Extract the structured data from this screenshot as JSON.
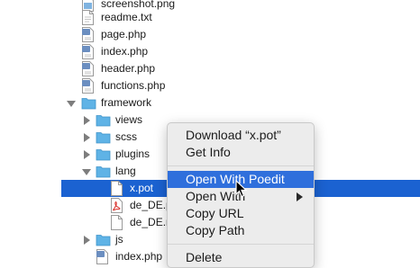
{
  "tree": {
    "items": [
      {
        "label": "screenshot.png",
        "type": "image"
      },
      {
        "label": "readme.txt",
        "type": "text"
      },
      {
        "label": "page.php",
        "type": "php"
      },
      {
        "label": "index.php",
        "type": "php"
      },
      {
        "label": "header.php",
        "type": "php"
      },
      {
        "label": "functions.php",
        "type": "php"
      },
      {
        "label": "framework",
        "type": "folder",
        "expanded": true
      },
      {
        "label": "views",
        "type": "folder",
        "expanded": false
      },
      {
        "label": "scss",
        "type": "folder",
        "expanded": false
      },
      {
        "label": "plugins",
        "type": "folder",
        "expanded": false
      },
      {
        "label": "lang",
        "type": "folder",
        "expanded": true
      },
      {
        "label": "x.pot",
        "type": "blank",
        "selected": true
      },
      {
        "label": "de_DE.po",
        "type": "pdf"
      },
      {
        "label": "de_DE.mo",
        "type": "text"
      },
      {
        "label": "js",
        "type": "folder",
        "expanded": false
      },
      {
        "label": "index.php",
        "type": "php"
      }
    ]
  },
  "context_menu": {
    "items": [
      {
        "label": "Download “x.pot”"
      },
      {
        "label": "Get Info"
      },
      {
        "label": "Open With Poedit",
        "highlighted": true
      },
      {
        "label": "Open With",
        "submenu": true
      },
      {
        "label": "Copy URL"
      },
      {
        "label": "Copy Path"
      },
      {
        "label": "Delete"
      }
    ]
  },
  "colors": {
    "selection": "#1b62d1",
    "menu_highlight": "#2f6fdc",
    "folder": "#5fb3e6",
    "php_icon": "#6b8ec0"
  }
}
